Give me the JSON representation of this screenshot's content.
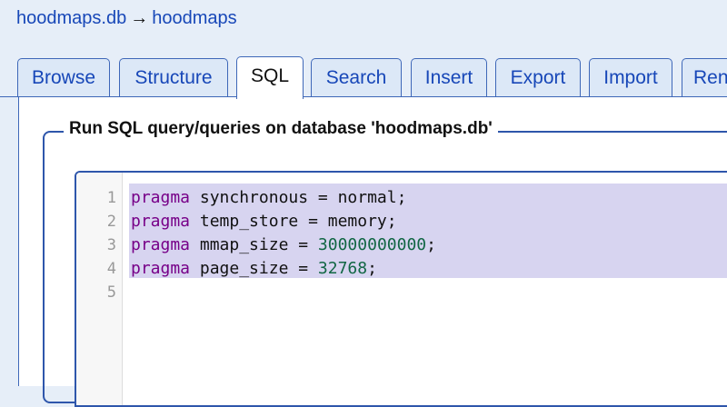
{
  "breadcrumb": {
    "database": "hoodmaps.db",
    "separator": "→",
    "table": "hoodmaps"
  },
  "tabs": [
    {
      "label": "Browse",
      "active": false
    },
    {
      "label": "Structure",
      "active": false
    },
    {
      "label": "SQL",
      "active": true
    },
    {
      "label": "Search",
      "active": false
    },
    {
      "label": "Insert",
      "active": false
    },
    {
      "label": "Export",
      "active": false
    },
    {
      "label": "Import",
      "active": false
    },
    {
      "label": "Rename",
      "active": false
    }
  ],
  "query_panel": {
    "legend": "Run SQL query/queries on database 'hoodmaps.db'"
  },
  "editor": {
    "line_numbers": [
      "1",
      "2",
      "3",
      "4",
      "5"
    ],
    "lines": [
      {
        "keyword": "pragma",
        "text": " synchronous = normal;",
        "number": "",
        "end": ""
      },
      {
        "keyword": "pragma",
        "text": " temp_store = memory;",
        "number": "",
        "end": ""
      },
      {
        "keyword": "pragma",
        "text": " mmap_size = ",
        "number": "30000000000",
        "end": ";"
      },
      {
        "keyword": "pragma",
        "text": " page_size = ",
        "number": "32768",
        "end": ";"
      }
    ],
    "selection_color": "#d7d4f0",
    "keyword_color": "#770088",
    "number_color": "#116644"
  },
  "colors": {
    "link": "#1747b8",
    "border": "#2e56ab",
    "page_background": "#e6eef8"
  }
}
